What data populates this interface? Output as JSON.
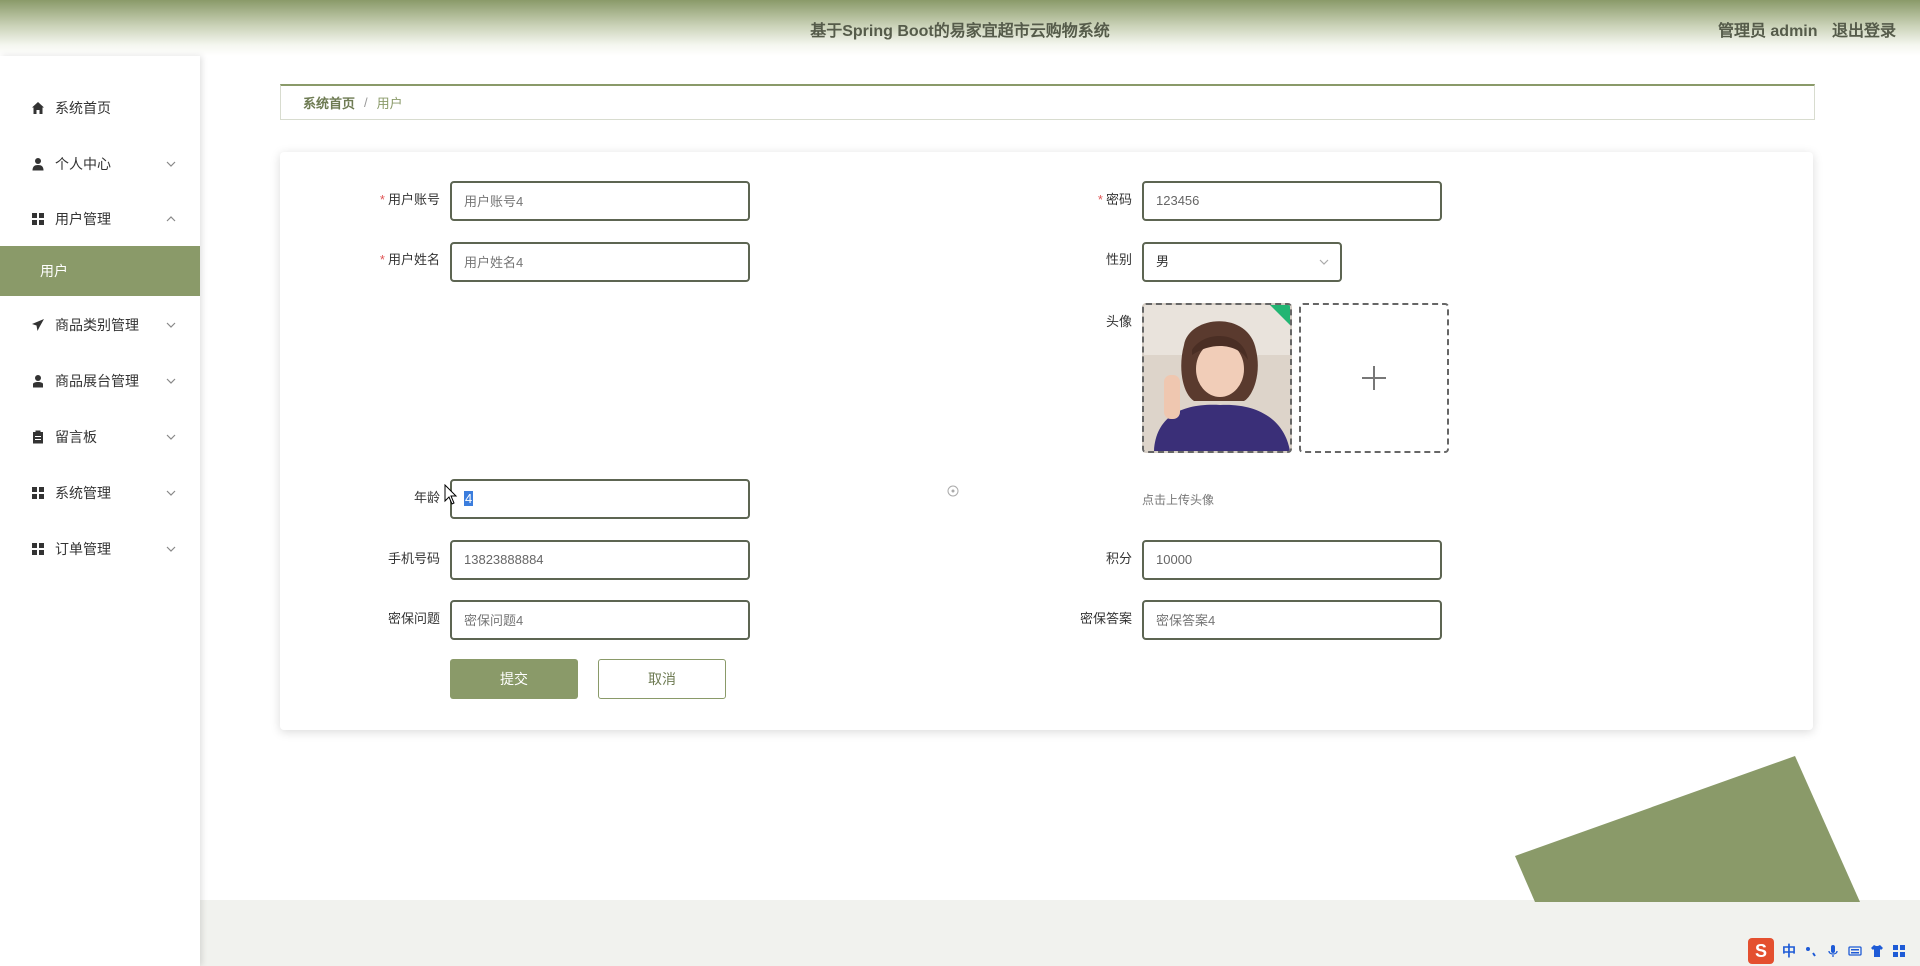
{
  "header": {
    "title": "基于Spring Boot的易家宜超市云购物系统",
    "user_label": "管理员 admin",
    "logout": "退出登录"
  },
  "sidebar": {
    "items": [
      {
        "label": "系统首页",
        "icon": "home-icon"
      },
      {
        "label": "个人中心",
        "icon": "person-icon",
        "expanded": false
      },
      {
        "label": "用户管理",
        "icon": "grid-icon",
        "expanded": true
      },
      {
        "label": "商品类别管理",
        "icon": "send-icon",
        "expanded": false
      },
      {
        "label": "商品展台管理",
        "icon": "person-icon",
        "expanded": false
      },
      {
        "label": "留言板",
        "icon": "clipboard-icon",
        "expanded": false
      },
      {
        "label": "系统管理",
        "icon": "grid-icon",
        "expanded": false
      },
      {
        "label": "订单管理",
        "icon": "grid-icon",
        "expanded": false
      }
    ],
    "active_sub": "用户"
  },
  "breadcrumb": {
    "home": "系统首页",
    "separator": "/",
    "current": "用户"
  },
  "form": {
    "account": {
      "label": "用户账号",
      "required": true,
      "placeholder": "用户账号4"
    },
    "password": {
      "label": "密码",
      "required": true,
      "value": "123456"
    },
    "name": {
      "label": "用户姓名",
      "required": true,
      "placeholder": "用户姓名4"
    },
    "gender": {
      "label": "性别",
      "value": "男"
    },
    "avatar": {
      "label": "头像",
      "tip": "点击上传头像"
    },
    "age": {
      "label": "年龄",
      "value": "4"
    },
    "phone": {
      "label": "手机号码",
      "value": "13823888884"
    },
    "points": {
      "label": "积分",
      "value": "10000"
    },
    "question": {
      "label": "密保问题",
      "placeholder": "密保问题4"
    },
    "answer": {
      "label": "密保答案",
      "placeholder": "密保答案4"
    },
    "submit": "提交",
    "cancel": "取消"
  },
  "ime": {
    "lang": "中"
  },
  "colors": {
    "accent": "#8a9a69",
    "required": "#e05555",
    "border": "#5d6552"
  }
}
